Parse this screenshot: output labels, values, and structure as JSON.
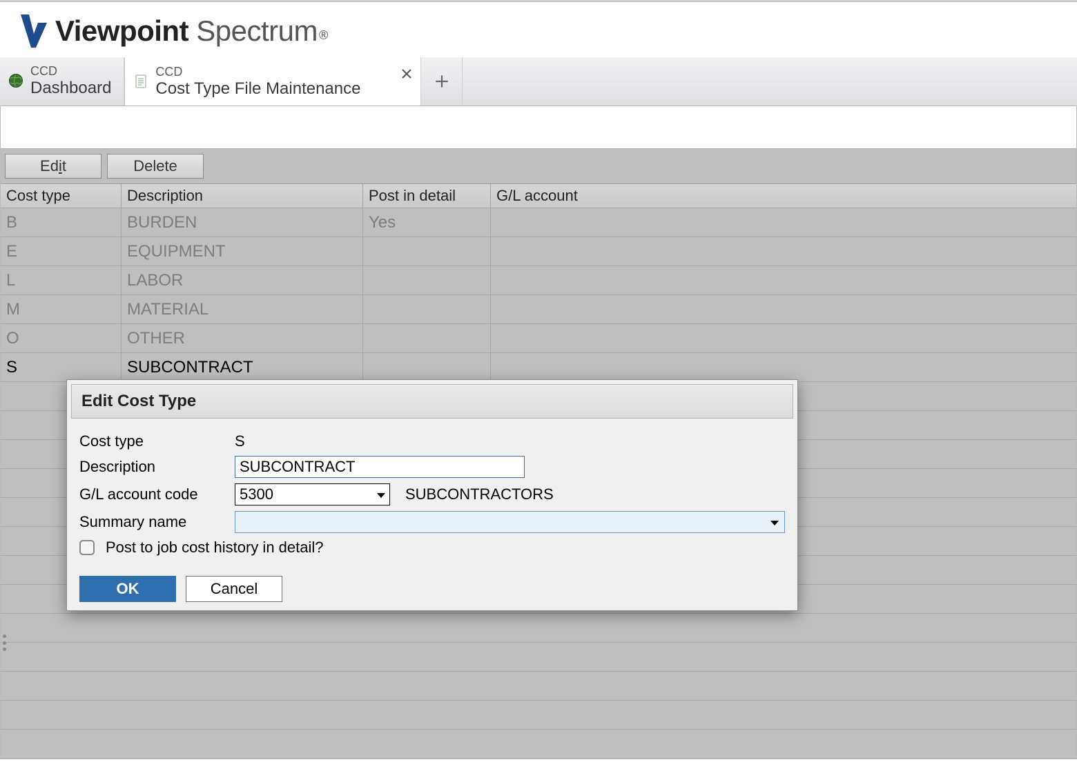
{
  "logo": {
    "bold": "Viewpoint",
    "light": "Spectrum"
  },
  "tabs": [
    {
      "sub": "CCD",
      "main": "Dashboard"
    },
    {
      "sub": "CCD",
      "main": "Cost Type File Maintenance"
    }
  ],
  "toolbar": {
    "edit_prefix": "Ed",
    "edit_u": "i",
    "edit_suffix": "t",
    "delete_label": "Delete"
  },
  "table": {
    "headers": {
      "costtype": "Cost type",
      "desc": "Description",
      "post": "Post in detail",
      "gl": "G/L account"
    },
    "rows": [
      {
        "costtype": "B",
        "desc": "BURDEN",
        "post": "Yes",
        "gl": ""
      },
      {
        "costtype": "E",
        "desc": "EQUIPMENT",
        "post": "",
        "gl": ""
      },
      {
        "costtype": "L",
        "desc": "LABOR",
        "post": "",
        "gl": ""
      },
      {
        "costtype": "M",
        "desc": "MATERIAL",
        "post": "",
        "gl": ""
      },
      {
        "costtype": "O",
        "desc": "OTHER",
        "post": "",
        "gl": ""
      },
      {
        "costtype": "S",
        "desc": "SUBCONTRACT",
        "post": "",
        "gl": ""
      }
    ]
  },
  "dialog": {
    "title": "Edit Cost Type",
    "labels": {
      "costtype": "Cost type",
      "desc": "Description",
      "gl": "G/L account code",
      "summary": "Summary name",
      "post_detail": "Post to job cost history in detail?"
    },
    "values": {
      "costtype": "S",
      "desc": "SUBCONTRACT",
      "gl_code": "5300",
      "gl_code_desc": "SUBCONTRACTORS",
      "summary": ""
    },
    "buttons": {
      "ok": "OK",
      "cancel": "Cancel"
    }
  }
}
